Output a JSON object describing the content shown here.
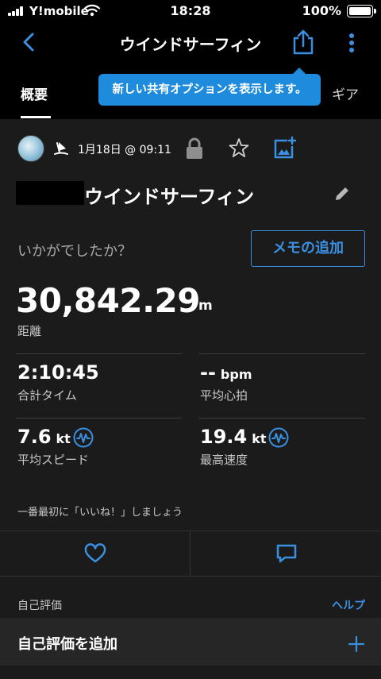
{
  "status_bar": {
    "carrier": "Y!mobile",
    "time": "18:28",
    "battery": "100%"
  },
  "nav": {
    "title": "ウインドサーフィン"
  },
  "tabs": {
    "overview": "概要",
    "gear": "ギア"
  },
  "tooltip": "新しい共有オプションを表示します。",
  "activity": {
    "date": "1月18日 @ 09:11",
    "title": "ウインドサーフィン"
  },
  "feel": {
    "prompt": "いかがでしたか？",
    "memo_button": "メモの追加"
  },
  "stats": {
    "distance": {
      "value": "30,842.29",
      "unit": "m",
      "label": "距離"
    },
    "total_time": {
      "value": "2:10:45",
      "label": "合計タイム"
    },
    "avg_hr": {
      "value": "--",
      "unit": "bpm",
      "label": "平均心拍"
    },
    "avg_speed": {
      "value": "7.6",
      "unit": "kt",
      "label": "平均スピード"
    },
    "max_speed": {
      "value": "19.4",
      "unit": "kt",
      "label": "最高速度"
    }
  },
  "like_prompt": "一番最初に「いいね！」しましょう",
  "self_eval": {
    "section": "自己評価",
    "help": "ヘルプ",
    "add": "自己評価を追加"
  },
  "colors": {
    "accent": "#3a8fe0",
    "tooltip": "#1e8bdc",
    "background": "#1b1b1c"
  }
}
